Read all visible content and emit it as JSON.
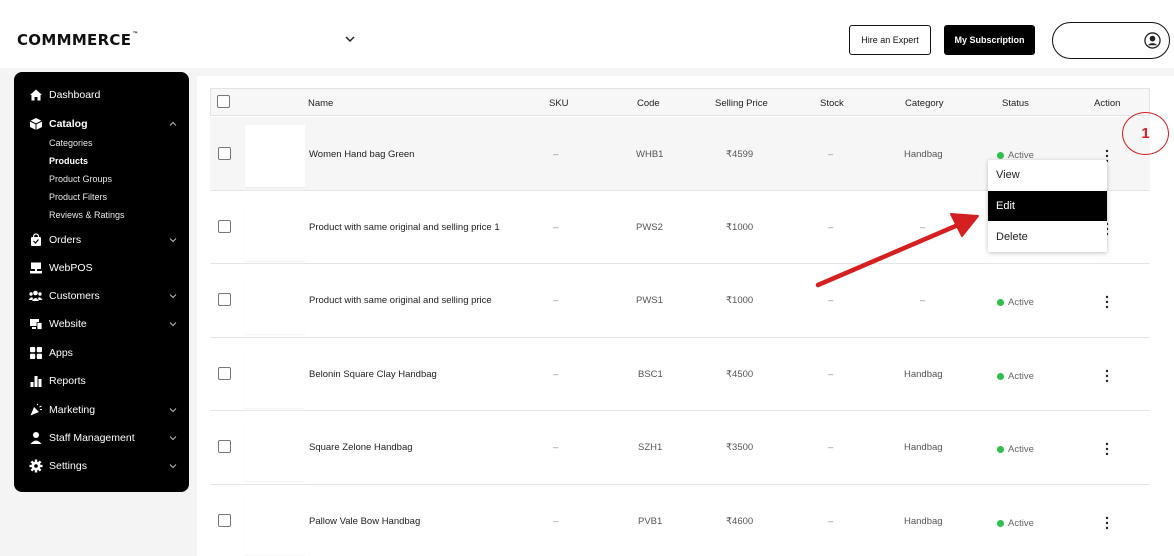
{
  "header": {
    "logo": "COMMMERCE",
    "logo_tm": "™",
    "hire_label": "Hire an Expert",
    "subscription_label": "My Subscription"
  },
  "sidebar": {
    "items": [
      {
        "label": "Dashboard",
        "icon": "home-icon"
      },
      {
        "label": "Catalog",
        "icon": "box-icon"
      },
      {
        "label": "Orders",
        "icon": "bag-icon"
      },
      {
        "label": "WebPOS",
        "icon": "pos-icon"
      },
      {
        "label": "Customers",
        "icon": "users-icon"
      },
      {
        "label": "Website",
        "icon": "website-icon"
      },
      {
        "label": "Apps",
        "icon": "apps-icon"
      },
      {
        "label": "Reports",
        "icon": "chart-icon"
      },
      {
        "label": "Marketing",
        "icon": "megaphone-icon"
      },
      {
        "label": "Staff Management",
        "icon": "staff-icon"
      },
      {
        "label": "Settings",
        "icon": "gear-icon"
      }
    ],
    "catalog_sub": [
      "Categories",
      "Products",
      "Product Groups",
      "Product Filters",
      "Reviews & Ratings"
    ],
    "active_sub": "Products"
  },
  "table": {
    "columns": [
      "Name",
      "SKU",
      "Code",
      "Selling Price",
      "Stock",
      "Category",
      "Status",
      "Action"
    ],
    "rows": [
      {
        "name": "Women Hand bag Green",
        "sku": "–",
        "code": "WHB1",
        "price": "₹4599",
        "stock": "–",
        "category": "Handbag",
        "status": "Active"
      },
      {
        "name": "Product with same original and selling price 1",
        "sku": "–",
        "code": "PWS2",
        "price": "₹1000",
        "stock": "–",
        "category": "–",
        "status": ""
      },
      {
        "name": "Product with same original and selling price",
        "sku": "–",
        "code": "PWS1",
        "price": "₹1000",
        "stock": "–",
        "category": "–",
        "status": "Active"
      },
      {
        "name": "Belonin Square Clay Handbag",
        "sku": "–",
        "code": "BSC1",
        "price": "₹4500",
        "stock": "–",
        "category": "Handbag",
        "status": "Active"
      },
      {
        "name": "Square Zelone Handbag",
        "sku": "–",
        "code": "SZH1",
        "price": "₹3500",
        "stock": "–",
        "category": "Handbag",
        "status": "Active"
      },
      {
        "name": "Pallow Vale Bow Handbag",
        "sku": "–",
        "code": "PVB1",
        "price": "₹4600",
        "stock": "–",
        "category": "Handbag",
        "status": "Active"
      }
    ]
  },
  "dropdown": {
    "items": [
      "View",
      "Edit",
      "Delete"
    ],
    "active": "Edit"
  },
  "annotation": {
    "number": "1",
    "color": "#d42020"
  },
  "colors": {
    "status_active": "#2fbf4d",
    "sidebar_bg": "#000000"
  }
}
